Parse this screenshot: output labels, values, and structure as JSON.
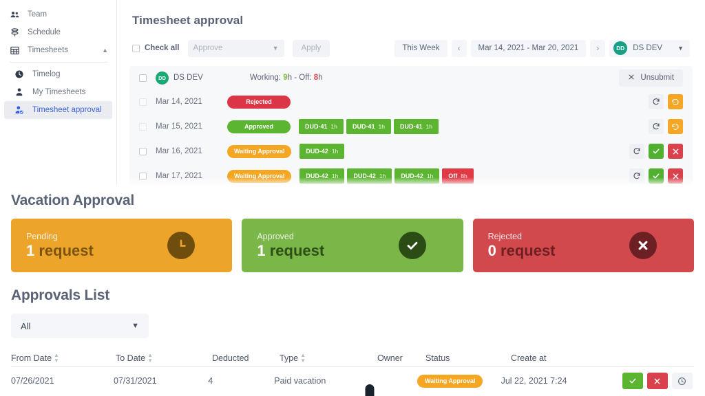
{
  "sidebar": {
    "items": [
      {
        "label": "Team",
        "icon": "people-icon",
        "active": false
      },
      {
        "label": "Schedule",
        "icon": "schedule-icon",
        "active": false
      },
      {
        "label": "Timesheets",
        "icon": "grid-icon",
        "active": false,
        "expanded": true
      },
      {
        "label": "Timelog",
        "icon": "clock-icon",
        "active": false,
        "sub": true
      },
      {
        "label": "My Timesheets",
        "icon": "person-icon",
        "active": false,
        "sub": true
      },
      {
        "label": "Timesheet approval",
        "icon": "person-check-icon",
        "active": true,
        "sub": true
      }
    ]
  },
  "timesheet": {
    "page_title": "Timesheet approval",
    "toolbar": {
      "check_all_label": "Check all",
      "action_select_value": "Approve",
      "apply_label": "Apply",
      "range_preset": "This Week",
      "prev_label": "‹",
      "date_range": "Mar 14, 2021 - Mar 20, 2021",
      "next_label": "›",
      "user_initials": "DD",
      "user_name": "DS DEV"
    },
    "group": {
      "initials": "DD",
      "name": "DS DEV",
      "working_label": "Working:",
      "working_value": "9",
      "working_unit": "h",
      "off_label": "Off:",
      "off_value": "8",
      "off_unit": "h",
      "unsubmit_label": "Unsubmit"
    },
    "rows": [
      {
        "date": "Mar 14, 2021",
        "status": "Rejected",
        "status_kind": "st-rejected",
        "chips": [],
        "actions": [
          "refresh",
          "undo"
        ]
      },
      {
        "date": "Mar 15, 2021",
        "status": "Approved",
        "status_kind": "st-approved",
        "chips": [
          {
            "task": "DUD-41",
            "hours": "1h",
            "kind": "chip-green"
          },
          {
            "task": "DUD-41",
            "hours": "1h",
            "kind": "chip-green"
          },
          {
            "task": "DUD-41",
            "hours": "1h",
            "kind": "chip-green"
          }
        ],
        "actions": [
          "refresh",
          "undo"
        ]
      },
      {
        "date": "Mar 16, 2021",
        "status": "Waiting Approval",
        "status_kind": "st-waiting",
        "chips": [
          {
            "task": "DUD-42",
            "hours": "1h",
            "kind": "chip-green"
          }
        ],
        "actions": [
          "refresh",
          "ok",
          "no"
        ]
      },
      {
        "date": "Mar 17, 2021",
        "status": "Waiting Approval",
        "status_kind": "st-waiting",
        "chips": [
          {
            "task": "DUD-42",
            "hours": "1h",
            "kind": "chip-green"
          },
          {
            "task": "DUD-42",
            "hours": "1h",
            "kind": "chip-green"
          },
          {
            "task": "DUD-42",
            "hours": "1h",
            "kind": "chip-green"
          },
          {
            "task": "Off",
            "hours": "8h",
            "kind": "chip-red"
          }
        ],
        "actions": [
          "refresh",
          "ok",
          "no"
        ]
      }
    ]
  },
  "vacation": {
    "title": "Vacation Approval",
    "cards": [
      {
        "label": "Pending",
        "count": "1",
        "unit": "request",
        "icon": "clock-icon",
        "class": "card-pending",
        "color": "#eda42a"
      },
      {
        "label": "Approved",
        "count": "1",
        "unit": "request",
        "icon": "check-icon",
        "class": "card-approved",
        "color": "#7ab648"
      },
      {
        "label": "Rejected",
        "count": "0",
        "unit": "request",
        "icon": "close-icon",
        "class": "card-rejected",
        "color": "#d2494d"
      }
    ]
  },
  "approvals": {
    "title": "Approvals List",
    "filter_value": "All",
    "columns": [
      {
        "label": "From Date",
        "sortable": true
      },
      {
        "label": "To Date",
        "sortable": true
      },
      {
        "label": "Deducted",
        "sortable": false
      },
      {
        "label": "Type",
        "sortable": true
      },
      {
        "label": "Owner",
        "sortable": false
      },
      {
        "label": "Status",
        "sortable": false
      },
      {
        "label": "Create at",
        "sortable": false
      }
    ],
    "rows": [
      {
        "from_date": "07/26/2021",
        "to_date": "07/31/2021",
        "deducted": "4",
        "type": "Paid vacation",
        "owner": "avatar",
        "status": "Waiting Approval",
        "create_at": "Jul 22, 2021 7:24",
        "actions": [
          "ok",
          "no",
          "info"
        ]
      }
    ]
  }
}
